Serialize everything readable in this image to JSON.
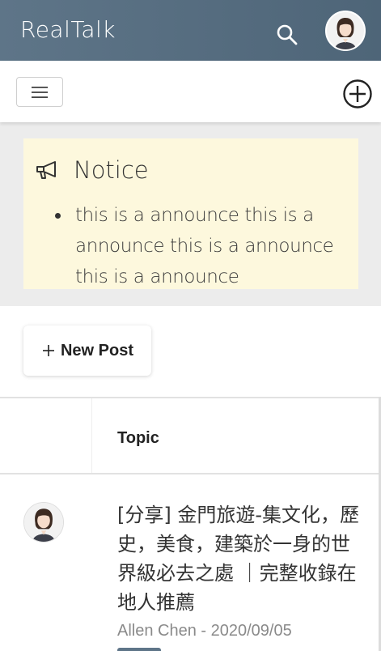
{
  "app": {
    "brand": "RealTalk"
  },
  "header": {
    "search_icon": "search-icon",
    "avatar_icon": "user-avatar"
  },
  "toolbar": {
    "menu_icon": "hamburger-icon",
    "add_icon": "plus-circle-icon"
  },
  "notice": {
    "title": "Notice",
    "icon": "megaphone-icon",
    "items": [
      "this is a announce this is a announce this is a announce this is a announce"
    ],
    "background": "#fdf8dd"
  },
  "actions": {
    "new_post_label": "New Post",
    "new_post_icon": "plus-icon"
  },
  "table": {
    "columns": [
      "",
      "Topic"
    ],
    "rows": [
      {
        "title": "[分享] 金門旅遊-集文化，歷史，美食，建築於一身的世界級必去之處 ｜完整收錄在地人推薦",
        "meta": "Allen Chen - 2020/09/05"
      }
    ]
  },
  "colors": {
    "header": "#5e7588",
    "accent": "#5e7588"
  }
}
